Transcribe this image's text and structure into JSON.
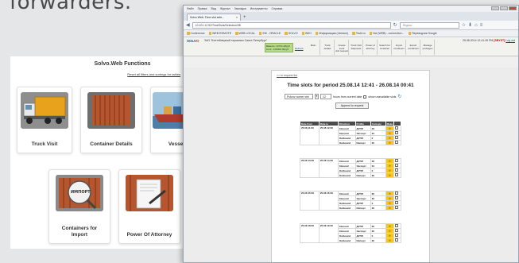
{
  "slide": {
    "heading": "forwarders."
  },
  "functions": {
    "title": "Solvo.Web Functions",
    "reset_link": "Reset all filters and sortings for tables",
    "tiles": [
      {
        "label": "Truck Visit"
      },
      {
        "label": "Container Details"
      },
      {
        "label": "Vessel"
      },
      {
        "label": "Containers for Import",
        "picture_text": "ИМПОРТ"
      },
      {
        "label": "Power Of Attorney"
      }
    ]
  },
  "browser": {
    "menu": [
      "Файл",
      "Правка",
      "Вид",
      "Журнал",
      "Закладки",
      "Инструменты",
      "Справка"
    ],
    "tab": {
      "title": "Solvo.Web: Time slot sele...",
      "close": "×"
    },
    "new_tab": "+",
    "url": "10.101.12.52/TimeSlots/Selection/38",
    "search_placeholder": "Яндекс",
    "bookmarks": [
      "Conference",
      "WEB REMOTE",
      "WEB LOCAL",
      "EM - ORACLE",
      "SOLVO",
      "WIKI",
      "Информация (Jeedom)",
      "Tsvkl.ru",
      "Ncl (WEB) - connection...",
      "Переводчик Google"
    ],
    "colors": {
      "tab_active": "#f6f7f8",
      "bookmark_icon": "#e6b73e",
      "close_button": "#c74747"
    }
  },
  "app": {
    "logo_prefix": "SOLV",
    "logo_suffix": "O",
    "terminal_name": "ЗАО \"Контейнерный терминал Санкт-Петербург\"",
    "balance_line1": "Balance: 43741.28руб",
    "balance_line2": "Limit: -100000.00руб",
    "refresh_label": "Refresh",
    "menu_items": [
      {
        "line1": "Main",
        "line2": ""
      },
      {
        "line1": "Truck",
        "line2": "details"
      },
      {
        "line1": "Create truck",
        "line2": "visit request"
      },
      {
        "line1": "Truck Visit",
        "line2": "Requests"
      },
      {
        "line1": "Power of",
        "line2": "attorney"
      },
      {
        "line1": "Search for",
        "line2": "container"
      },
      {
        "line1": "Import",
        "line2": "containers"
      },
      {
        "line1": "Export",
        "line2": "containers"
      },
      {
        "line1": "Manage",
        "line2": "privileges"
      }
    ],
    "datetime": "25.08.2014 12:41:39 PM",
    "user": "[SBYST]",
    "logout": "Log out",
    "colors": {
      "balance_bg": "#b7dc85",
      "logo_blue": "#1f4f86",
      "logo_red": "#c73a2e"
    }
  },
  "timeslots": {
    "back_link": "<< to request list",
    "title": "Time slots for period 25.08.14 12:41 - 26.08.14 00:41",
    "vehicle_select": "Polzov nomer veh",
    "stepper": "▾",
    "hours_value": "12",
    "hours_label": "hours from current date",
    "show_unavailable_label": "show unavailable slots",
    "append_button": "Append to request",
    "columns": [
      "Date from",
      "Date to",
      "Direction",
      "Profile",
      "Cont.qty",
      "Make",
      ""
    ],
    "colors": {
      "header_bg": "#4a4a4a",
      "star_bg": "#f3c623"
    },
    "groups": [
      {
        "from": "25.08 11:00",
        "to": "25.08 12:00",
        "rows": [
          {
            "direction": "Inbound",
            "profile": "ДУПЛ",
            "qty": "29"
          },
          {
            "direction": "Inbound",
            "profile": "Экспорт",
            "qty": "24"
          },
          {
            "direction": "Outbound",
            "profile": "ДУПЛ",
            "qty": "0"
          },
          {
            "direction": "Outbound",
            "profile": "Импорт",
            "qty": "30"
          }
        ]
      },
      {
        "from": "25.08 13:30",
        "to": "25.08 14:00",
        "rows": [
          {
            "direction": "Inbound",
            "profile": "ДУПЛ",
            "qty": "29"
          },
          {
            "direction": "Inbound",
            "profile": "Экспорт",
            "qty": "24"
          },
          {
            "direction": "Outbound",
            "profile": "ДУПЛ",
            "qty": "0"
          },
          {
            "direction": "Outbound",
            "profile": "Импорт",
            "qty": "30"
          }
        ]
      },
      {
        "from": "25.08 15:00",
        "to": "25.08 16:00",
        "rows": [
          {
            "direction": "Inbound",
            "profile": "ДУПЛ",
            "qty": "30"
          },
          {
            "direction": "Inbound",
            "profile": "Экспорт",
            "qty": "30"
          },
          {
            "direction": "Outbound",
            "profile": "ДУПЛ",
            "qty": "0"
          },
          {
            "direction": "Outbound",
            "profile": "Импорт",
            "qty": "30"
          }
        ]
      },
      {
        "from": "25.08 18:00",
        "to": "25.08 19:00",
        "rows": [
          {
            "direction": "Inbound",
            "profile": "ДУПЛ",
            "qty": "30"
          },
          {
            "direction": "Inbound",
            "profile": "Экспорт",
            "qty": "30"
          },
          {
            "direction": "Outbound",
            "profile": "ДУПЛ",
            "qty": "0"
          },
          {
            "direction": "Outbound",
            "profile": "Импорт",
            "qty": "30"
          }
        ]
      }
    ]
  }
}
